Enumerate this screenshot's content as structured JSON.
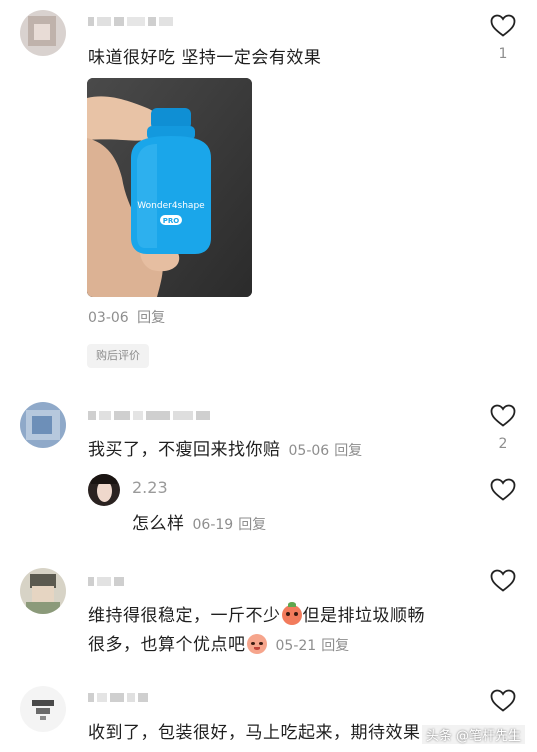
{
  "comments": [
    {
      "text": "味道很好吃 坚持一定会有效果",
      "date": "03-06",
      "reply_label": "回复",
      "tag": "购后评价",
      "likes": "1"
    },
    {
      "text": "我买了，不瘦回来找你赔",
      "date": "05-06",
      "reply_label": "回复",
      "likes": "2",
      "reply": {
        "username": "2.23",
        "text": "怎么样",
        "date": "06-19",
        "reply_label": "回复"
      }
    },
    {
      "text_line1_a": "维持得很稳定，一斤不少",
      "text_line1_b": "但是排垃圾顺畅",
      "text_line2": "很多，也算个优点吧",
      "date": "05-21",
      "reply_label": "回复"
    },
    {
      "text": "收到了，包装很好，马上吃起来，期待效果"
    }
  ],
  "product": {
    "brand": "Wonder4shape",
    "badge": "PRO"
  },
  "watermark": "头条 @笔杆先生",
  "colors": {
    "bottle": "#1aa6ea",
    "heart_stroke": "#222222",
    "meta": "#8e8e8e"
  }
}
